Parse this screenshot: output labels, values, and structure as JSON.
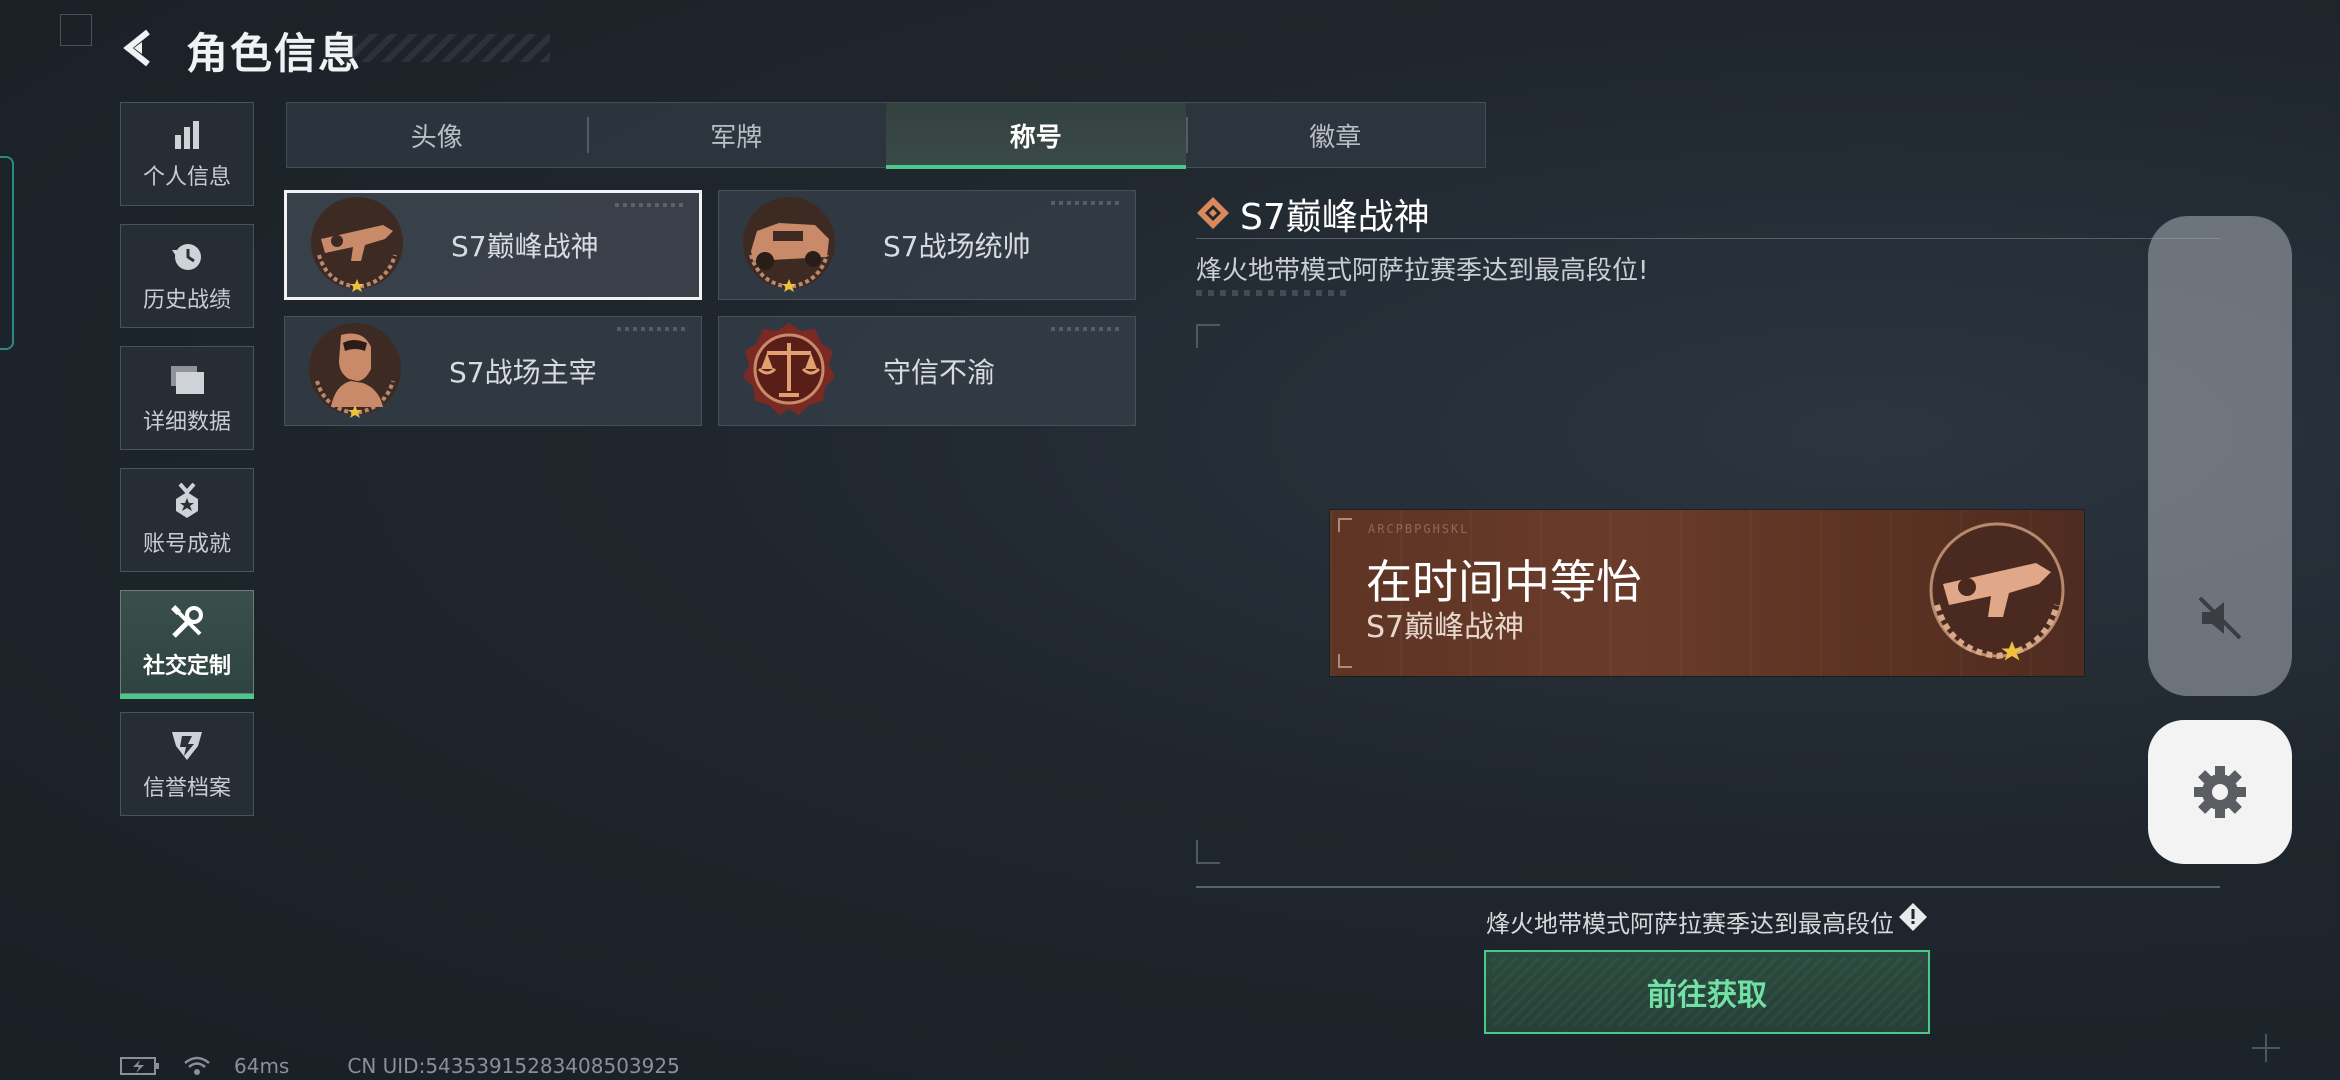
{
  "header": {
    "title": "角色信息"
  },
  "sidebar": {
    "items": [
      {
        "label": "个人信息",
        "icon": "bar-chart-icon",
        "active": false
      },
      {
        "label": "历史战绩",
        "icon": "history-clock-icon",
        "active": false
      },
      {
        "label": "详细数据",
        "icon": "folder-stack-icon",
        "active": false
      },
      {
        "label": "账号成就",
        "icon": "medal-icon",
        "active": false
      },
      {
        "label": "社交定制",
        "icon": "tools-icon",
        "active": true
      },
      {
        "label": "信誉档案",
        "icon": "shield-emblem-icon",
        "active": false
      }
    ]
  },
  "tabs": [
    {
      "label": "头像",
      "active": false
    },
    {
      "label": "军牌",
      "active": false
    },
    {
      "label": "称号",
      "active": true
    },
    {
      "label": "徽章",
      "active": false
    }
  ],
  "titles": [
    {
      "name": "S7巅峰战神",
      "emblem": "rifle-emblem-icon",
      "selected": true
    },
    {
      "name": "S7战场统帅",
      "emblem": "armored-vehicle-emblem-icon",
      "selected": false
    },
    {
      "name": "S7战场主宰",
      "emblem": "warrior-bust-emblem-icon",
      "selected": false
    },
    {
      "name": "守信不渝",
      "emblem": "justice-scales-emblem-icon",
      "selected": false
    }
  ],
  "detail": {
    "title": "S7巅峰战神",
    "description": "烽火地带模式阿萨拉赛季达到最高段位!",
    "banner": {
      "code": "ARCPBPGHSKL",
      "main_text": "在时间中等怡",
      "sub_text": "S7巅峰战神"
    },
    "requirement": "烽火地带模式阿萨拉赛季达到最高段位",
    "action_label": "前往获取"
  },
  "status_bar": {
    "ping": "64ms",
    "uid": "CN UID:54353915283408503925"
  },
  "colors": {
    "accent_green": "#49c98b",
    "banner_brown": "#6a3b2a",
    "emblem_copper": "#c98a6a"
  }
}
